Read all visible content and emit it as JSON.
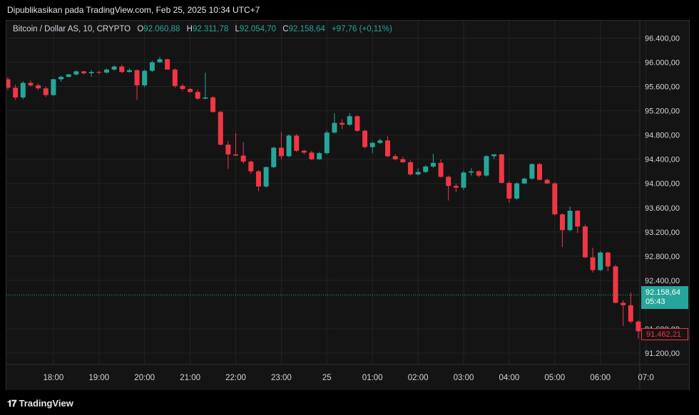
{
  "publisher": "Dipublikasikan pada TradingView.com, Feb 25, 2025 10:34 UTC+7",
  "legend": {
    "symbol": "Bitcoin / Dollar AS, 10, CRYPTO",
    "o_label": "O",
    "o": "92.060,88",
    "h_label": "H",
    "h": "92.311,78",
    "l_label": "L",
    "l": "92.054,70",
    "c_label": "C",
    "c": "92.158,64",
    "change": "+97,76 (+0,11%)"
  },
  "last_price": {
    "price": "92.158,64",
    "countdown": "05:43"
  },
  "low_marker": "91.462,21",
  "brand": "TradingView",
  "colors": {
    "up": "#26a69a",
    "down": "#f23645",
    "grid": "#242424",
    "axis_text": "#d1d4dc"
  },
  "chart_data": {
    "type": "candlestick",
    "title": "Bitcoin / Dollar AS, 10, CRYPTO",
    "ylim": [
      91000,
      96600
    ],
    "y_ticks": [
      {
        "value": 91200,
        "label": "91.200,00"
      },
      {
        "value": 91600,
        "label": "91.600,00"
      },
      {
        "value": 92400,
        "label": "92.400,00"
      },
      {
        "value": 92800,
        "label": "92.800,00"
      },
      {
        "value": 93200,
        "label": "93.200,00"
      },
      {
        "value": 93600,
        "label": "93.600,00"
      },
      {
        "value": 94000,
        "label": "94.000,00"
      },
      {
        "value": 94400,
        "label": "94.400,00"
      },
      {
        "value": 94800,
        "label": "94.800,00"
      },
      {
        "value": 95200,
        "label": "95.200,00"
      },
      {
        "value": 95600,
        "label": "95.600,00"
      },
      {
        "value": 96000,
        "label": "96.000,00"
      },
      {
        "value": 96400,
        "label": "96.400,00"
      }
    ],
    "x_ticks": [
      {
        "index": 6,
        "label": "18:00"
      },
      {
        "index": 12,
        "label": "19:00"
      },
      {
        "index": 18,
        "label": "20:00"
      },
      {
        "index": 24,
        "label": "21:00"
      },
      {
        "index": 30,
        "label": "22:00"
      },
      {
        "index": 36,
        "label": "23:00"
      },
      {
        "index": 42,
        "label": "25"
      },
      {
        "index": 48,
        "label": "01:00"
      },
      {
        "index": 54,
        "label": "02:00"
      },
      {
        "index": 60,
        "label": "03:00"
      },
      {
        "index": 66,
        "label": "04:00"
      },
      {
        "index": 72,
        "label": "05:00"
      },
      {
        "index": 78,
        "label": "06:00"
      },
      {
        "index": 84,
        "label": "07:0"
      }
    ],
    "candles": [
      {
        "o": 95720,
        "h": 95760,
        "l": 95540,
        "c": 95580
      },
      {
        "o": 95580,
        "h": 95630,
        "l": 95380,
        "c": 95420
      },
      {
        "o": 95420,
        "h": 95690,
        "l": 95390,
        "c": 95660
      },
      {
        "o": 95660,
        "h": 95700,
        "l": 95600,
        "c": 95620
      },
      {
        "o": 95620,
        "h": 95650,
        "l": 95540,
        "c": 95570
      },
      {
        "o": 95570,
        "h": 95600,
        "l": 95430,
        "c": 95460
      },
      {
        "o": 95460,
        "h": 95730,
        "l": 95440,
        "c": 95720
      },
      {
        "o": 95720,
        "h": 95780,
        "l": 95680,
        "c": 95760
      },
      {
        "o": 95760,
        "h": 95810,
        "l": 95750,
        "c": 95800
      },
      {
        "o": 95800,
        "h": 95870,
        "l": 95780,
        "c": 95850
      },
      {
        "o": 95850,
        "h": 95860,
        "l": 95800,
        "c": 95820
      },
      {
        "o": 95820,
        "h": 95870,
        "l": 95760,
        "c": 95840
      },
      {
        "o": 95840,
        "h": 95860,
        "l": 95800,
        "c": 95830
      },
      {
        "o": 95830,
        "h": 95900,
        "l": 95810,
        "c": 95880
      },
      {
        "o": 95880,
        "h": 95950,
        "l": 95860,
        "c": 95930
      },
      {
        "o": 95930,
        "h": 95960,
        "l": 95820,
        "c": 95840
      },
      {
        "o": 95840,
        "h": 95900,
        "l": 95830,
        "c": 95870
      },
      {
        "o": 95870,
        "h": 95880,
        "l": 95380,
        "c": 95620
      },
      {
        "o": 95620,
        "h": 95880,
        "l": 95590,
        "c": 95860
      },
      {
        "o": 95860,
        "h": 96030,
        "l": 95840,
        "c": 96000
      },
      {
        "o": 96000,
        "h": 96090,
        "l": 95990,
        "c": 96050
      },
      {
        "o": 96050,
        "h": 96060,
        "l": 95880,
        "c": 95880
      },
      {
        "o": 95880,
        "h": 95900,
        "l": 95580,
        "c": 95610
      },
      {
        "o": 95610,
        "h": 95640,
        "l": 95530,
        "c": 95560
      },
      {
        "o": 95560,
        "h": 95580,
        "l": 95500,
        "c": 95510
      },
      {
        "o": 95510,
        "h": 95550,
        "l": 95380,
        "c": 95400
      },
      {
        "o": 95400,
        "h": 95830,
        "l": 95390,
        "c": 95420
      },
      {
        "o": 95420,
        "h": 95440,
        "l": 95170,
        "c": 95180
      },
      {
        "o": 95180,
        "h": 95200,
        "l": 94630,
        "c": 94640
      },
      {
        "o": 94640,
        "h": 94700,
        "l": 94240,
        "c": 94480
      },
      {
        "o": 94480,
        "h": 94830,
        "l": 94460,
        "c": 94460
      },
      {
        "o": 94460,
        "h": 94680,
        "l": 94330,
        "c": 94360
      },
      {
        "o": 94360,
        "h": 94380,
        "l": 94160,
        "c": 94200
      },
      {
        "o": 94200,
        "h": 94220,
        "l": 93870,
        "c": 93950
      },
      {
        "o": 93950,
        "h": 94280,
        "l": 93930,
        "c": 94270
      },
      {
        "o": 94270,
        "h": 94610,
        "l": 94250,
        "c": 94590
      },
      {
        "o": 94590,
        "h": 94850,
        "l": 94400,
        "c": 94450
      },
      {
        "o": 94450,
        "h": 94810,
        "l": 94430,
        "c": 94790
      },
      {
        "o": 94790,
        "h": 94820,
        "l": 94520,
        "c": 94540
      },
      {
        "o": 94540,
        "h": 94560,
        "l": 94480,
        "c": 94510
      },
      {
        "o": 94510,
        "h": 94540,
        "l": 94380,
        "c": 94400
      },
      {
        "o": 94400,
        "h": 94520,
        "l": 94390,
        "c": 94500
      },
      {
        "o": 94500,
        "h": 94870,
        "l": 94480,
        "c": 94840
      },
      {
        "o": 94840,
        "h": 95160,
        "l": 94820,
        "c": 95000
      },
      {
        "o": 95000,
        "h": 95060,
        "l": 94900,
        "c": 94970
      },
      {
        "o": 94970,
        "h": 95160,
        "l": 94950,
        "c": 95110
      },
      {
        "o": 95110,
        "h": 95130,
        "l": 94850,
        "c": 94870
      },
      {
        "o": 94870,
        "h": 94890,
        "l": 94580,
        "c": 94600
      },
      {
        "o": 94600,
        "h": 94690,
        "l": 94500,
        "c": 94670
      },
      {
        "o": 94670,
        "h": 94740,
        "l": 94650,
        "c": 94710
      },
      {
        "o": 94710,
        "h": 94780,
        "l": 94430,
        "c": 94450
      },
      {
        "o": 94450,
        "h": 94480,
        "l": 94380,
        "c": 94400
      },
      {
        "o": 94400,
        "h": 94440,
        "l": 94340,
        "c": 94350
      },
      {
        "o": 94350,
        "h": 94380,
        "l": 94130,
        "c": 94150
      },
      {
        "o": 94150,
        "h": 94250,
        "l": 94130,
        "c": 94190
      },
      {
        "o": 94190,
        "h": 94300,
        "l": 94170,
        "c": 94280
      },
      {
        "o": 94280,
        "h": 94490,
        "l": 94260,
        "c": 94340
      },
      {
        "o": 94340,
        "h": 94400,
        "l": 94100,
        "c": 94110
      },
      {
        "o": 94110,
        "h": 94130,
        "l": 93720,
        "c": 93960
      },
      {
        "o": 93960,
        "h": 94000,
        "l": 93860,
        "c": 93930
      },
      {
        "o": 93930,
        "h": 94210,
        "l": 93890,
        "c": 94180
      },
      {
        "o": 94180,
        "h": 94250,
        "l": 94130,
        "c": 94200
      },
      {
        "o": 94200,
        "h": 94220,
        "l": 94100,
        "c": 94130
      },
      {
        "o": 94130,
        "h": 94470,
        "l": 94110,
        "c": 94450
      },
      {
        "o": 94450,
        "h": 94480,
        "l": 94400,
        "c": 94480
      },
      {
        "o": 94480,
        "h": 94490,
        "l": 94000,
        "c": 94010
      },
      {
        "o": 94010,
        "h": 94040,
        "l": 93680,
        "c": 93750
      },
      {
        "o": 93750,
        "h": 94020,
        "l": 93730,
        "c": 94000
      },
      {
        "o": 94000,
        "h": 94100,
        "l": 93990,
        "c": 94080
      },
      {
        "o": 94080,
        "h": 94330,
        "l": 94060,
        "c": 94320
      },
      {
        "o": 94320,
        "h": 94340,
        "l": 94050,
        "c": 94060
      },
      {
        "o": 94060,
        "h": 94080,
        "l": 93990,
        "c": 94000
      },
      {
        "o": 94000,
        "h": 94020,
        "l": 93470,
        "c": 93490
      },
      {
        "o": 93490,
        "h": 93510,
        "l": 92950,
        "c": 93230
      },
      {
        "o": 93230,
        "h": 93620,
        "l": 93210,
        "c": 93550
      },
      {
        "o": 93550,
        "h": 93560,
        "l": 93180,
        "c": 93290
      },
      {
        "o": 93290,
        "h": 93320,
        "l": 92770,
        "c": 92780
      },
      {
        "o": 92780,
        "h": 92940,
        "l": 92530,
        "c": 92570
      },
      {
        "o": 92570,
        "h": 92880,
        "l": 92550,
        "c": 92860
      },
      {
        "o": 92860,
        "h": 92870,
        "l": 92550,
        "c": 92630
      },
      {
        "o": 92630,
        "h": 92660,
        "l": 92020,
        "c": 92030
      },
      {
        "o": 92030,
        "h": 92070,
        "l": 91650,
        "c": 91990
      },
      {
        "o": 91990,
        "h": 92200,
        "l": 91690,
        "c": 91720
      },
      {
        "o": 91720,
        "h": 91740,
        "l": 91440,
        "c": 91560
      },
      {
        "o": 91560,
        "h": 91980,
        "l": 91500,
        "c": 91480
      }
    ]
  }
}
